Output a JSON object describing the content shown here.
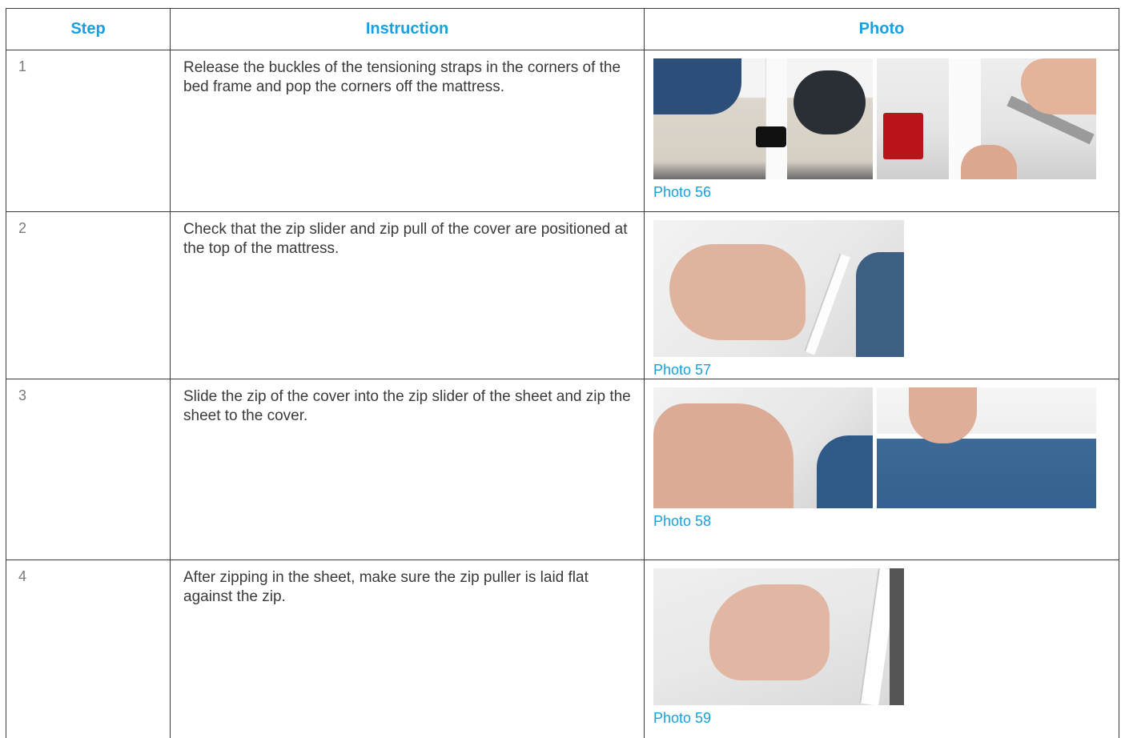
{
  "table": {
    "headers": {
      "step": "Step",
      "instruction": "Instruction",
      "photo": "Photo"
    },
    "rows": [
      {
        "step": "1",
        "instruction": "Release the buckles of the tensioning straps in the corners of the bed frame and pop the corners off the mattress.",
        "caption": "Photo 56"
      },
      {
        "step": "2",
        "instruction": "Check that the zip slider and zip pull of the cover are positioned at the top of the mattress.",
        "caption": "Photo 57"
      },
      {
        "step": "3",
        "instruction": "Slide the zip of the cover into the zip slider of the sheet and zip the sheet to the cover.",
        "caption": "Photo 58"
      },
      {
        "step": "4",
        "instruction": "After zipping in the sheet, make sure the zip puller is laid flat against the zip.",
        "caption": "Photo 59"
      }
    ]
  },
  "colors": {
    "accent": "#1aa0dc",
    "text": "#3a3a3a",
    "border": "#3a3a3a"
  }
}
